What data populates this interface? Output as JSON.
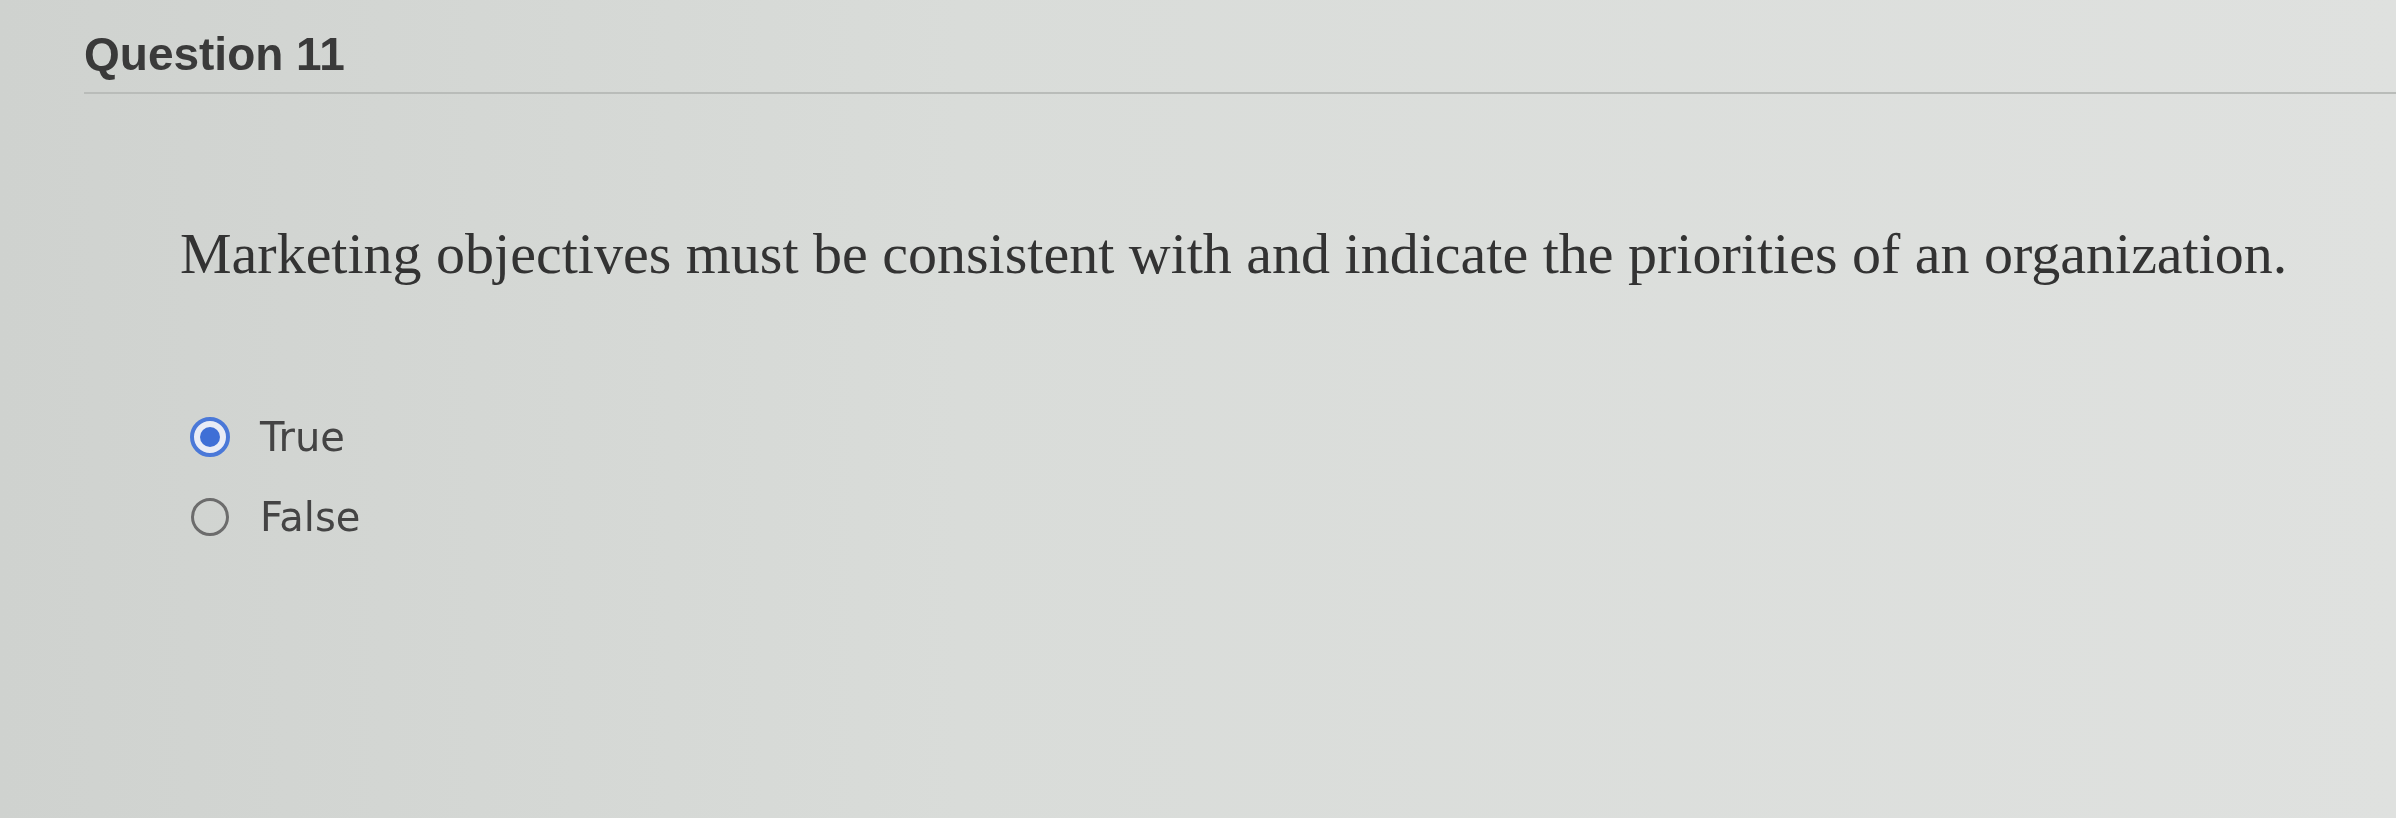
{
  "question": {
    "title": "Question 11",
    "text": "Marketing objectives must be consistent with and indicate the priorities of an organization."
  },
  "options": [
    {
      "label": "True",
      "selected": true
    },
    {
      "label": "False",
      "selected": false
    }
  ]
}
